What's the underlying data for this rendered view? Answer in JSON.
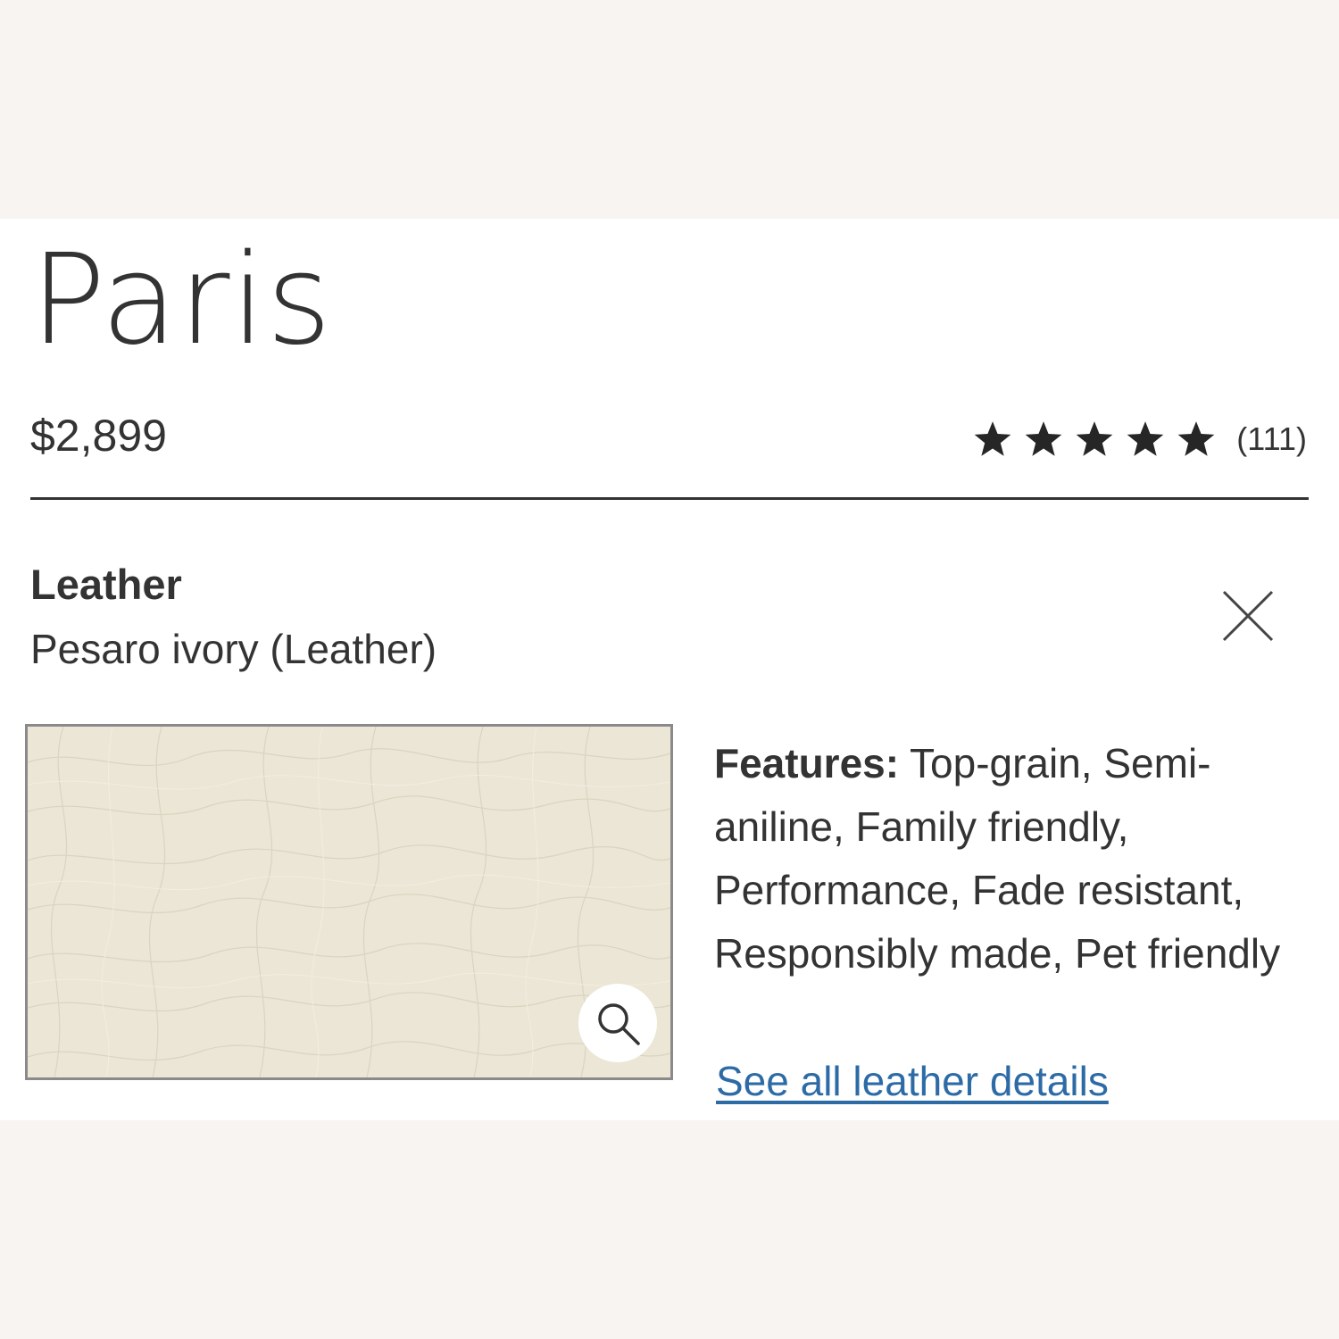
{
  "product": {
    "title": "Paris",
    "price": "$2,899"
  },
  "rating": {
    "stars": 5,
    "max_stars": 5,
    "review_count": "(111)"
  },
  "material": {
    "section_label": "Leather",
    "selected_value": "Pesaro ivory (Leather)",
    "close_icon": "close-icon",
    "swatch_color": "#ebe6d5",
    "zoom_icon": "magnifier-icon"
  },
  "features": {
    "label": "Features:",
    "text": " Top-grain, Semi-aniline, Family friendly, Performance, Fade resistant, Responsibly made, Pet friendly"
  },
  "details_link": {
    "label": "See all leather details"
  },
  "colors": {
    "page_background": "#f7f4f1",
    "panel_background": "#ffffff",
    "text": "#333333",
    "link": "#2d6ba6"
  }
}
